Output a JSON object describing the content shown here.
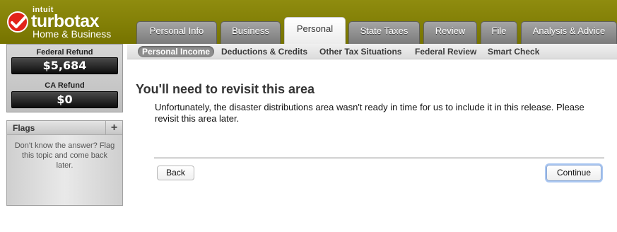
{
  "brand": {
    "company": "intuit",
    "product": "turbotax",
    "edition": "Home & Business"
  },
  "tabs": [
    {
      "label": "Personal Info",
      "active": false
    },
    {
      "label": "Business",
      "active": false
    },
    {
      "label": "Personal",
      "active": true
    },
    {
      "label": "State Taxes",
      "active": false
    },
    {
      "label": "Review",
      "active": false
    },
    {
      "label": "File",
      "active": false
    },
    {
      "label": "Analysis & Advice",
      "active": false
    }
  ],
  "subnav": [
    {
      "label": "Personal Income",
      "active": true
    },
    {
      "label": "Deductions & Credits",
      "active": false
    },
    {
      "label": "Other Tax Situations",
      "active": false
    },
    {
      "label": "Federal Review",
      "active": false
    },
    {
      "label": "Smart Check",
      "active": false
    }
  ],
  "refunds": {
    "federal_label": "Federal Refund",
    "federal_value": "$5,684",
    "state_label": "CA Refund",
    "state_value": "$0"
  },
  "flags": {
    "title": "Flags",
    "add_symbol": "+",
    "help_text": "Don't know the answer? Flag this topic and come back later."
  },
  "main": {
    "title": "You'll need to revisit this area",
    "message": "Unfortunately, the disaster distributions area wasn't ready in time for us to include it in this release. Please revisit this area later."
  },
  "buttons": {
    "back": "Back",
    "continue": "Continue"
  },
  "colors": {
    "header": "#827f06",
    "logo_check": "#e2231a",
    "continue_focus": "#a9c6f1"
  },
  "icons": {
    "logo_check": "checkmark-icon",
    "flags_add": "plus-icon"
  }
}
